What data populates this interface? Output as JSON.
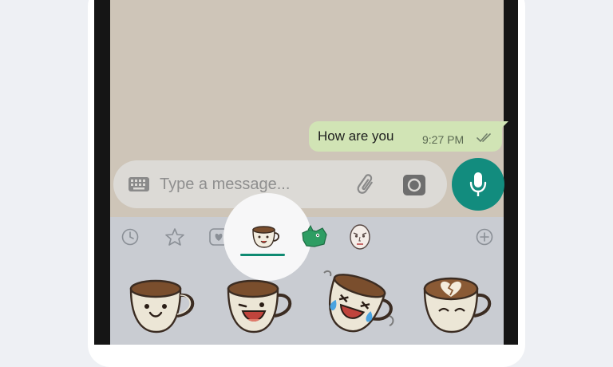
{
  "chat": {
    "message_text": "How are you",
    "message_time": "9:27 PM"
  },
  "composer": {
    "placeholder": "Type a message..."
  },
  "sticker_tray": {
    "tabs": [
      "recent-icon",
      "star-icon",
      "heart-sticker-icon",
      "coffee-cup-sticker-icon",
      "green-character-sticker-icon",
      "face-sticker-icon",
      "add-icon"
    ],
    "selected_tab": "coffee-cup-sticker-icon",
    "stickers": [
      "smiling-coffee-cup-sticker",
      "winking-coffee-cup-sticker",
      "laughing-crying-coffee-cup-sticker",
      "broken-heart-latte-sticker"
    ]
  },
  "colors": {
    "chat_background": "#cec5b8",
    "outgoing_bubble": "#d1e4b5",
    "accent_green": "#128c7e",
    "tab_indicator": "#0f8a72",
    "panel_background": "#c9ccd2"
  }
}
